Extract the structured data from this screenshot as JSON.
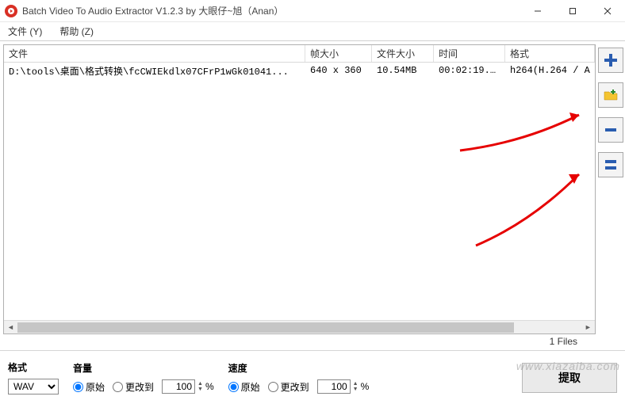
{
  "window": {
    "title": "Batch Video To Audio Extractor V1.2.3 by 大眼仔~旭（Anan）"
  },
  "menu": {
    "file": "文件 (Y)",
    "help": "帮助 (Z)"
  },
  "table": {
    "headers": {
      "file": "文件",
      "frame_size": "帧大小",
      "file_size": "文件大小",
      "time": "时间",
      "format": "格式"
    },
    "rows": [
      {
        "file": "D:\\tools\\桌面\\格式转换\\fcCWIEkdlx07CFrP1wGk01041...",
        "frame_size": "640 x 360",
        "file_size": "10.54MB",
        "time": "00:02:19...",
        "format": "h264(H.264 / A"
      }
    ]
  },
  "status": {
    "files": "1 Files"
  },
  "format": {
    "label": "格式",
    "selected": "WAV"
  },
  "volume": {
    "label": "音量",
    "original": "原始",
    "change_to": "更改到",
    "value": "100",
    "unit": "%"
  },
  "speed": {
    "label": "速度",
    "original": "原始",
    "change_to": "更改到",
    "value": "100",
    "unit": "%"
  },
  "extract": {
    "label": "提取"
  },
  "sidebar": {
    "add": "add",
    "add_folder": "add-folder",
    "remove": "remove",
    "clear": "clear"
  },
  "watermark": "www.xiazaiba.com"
}
